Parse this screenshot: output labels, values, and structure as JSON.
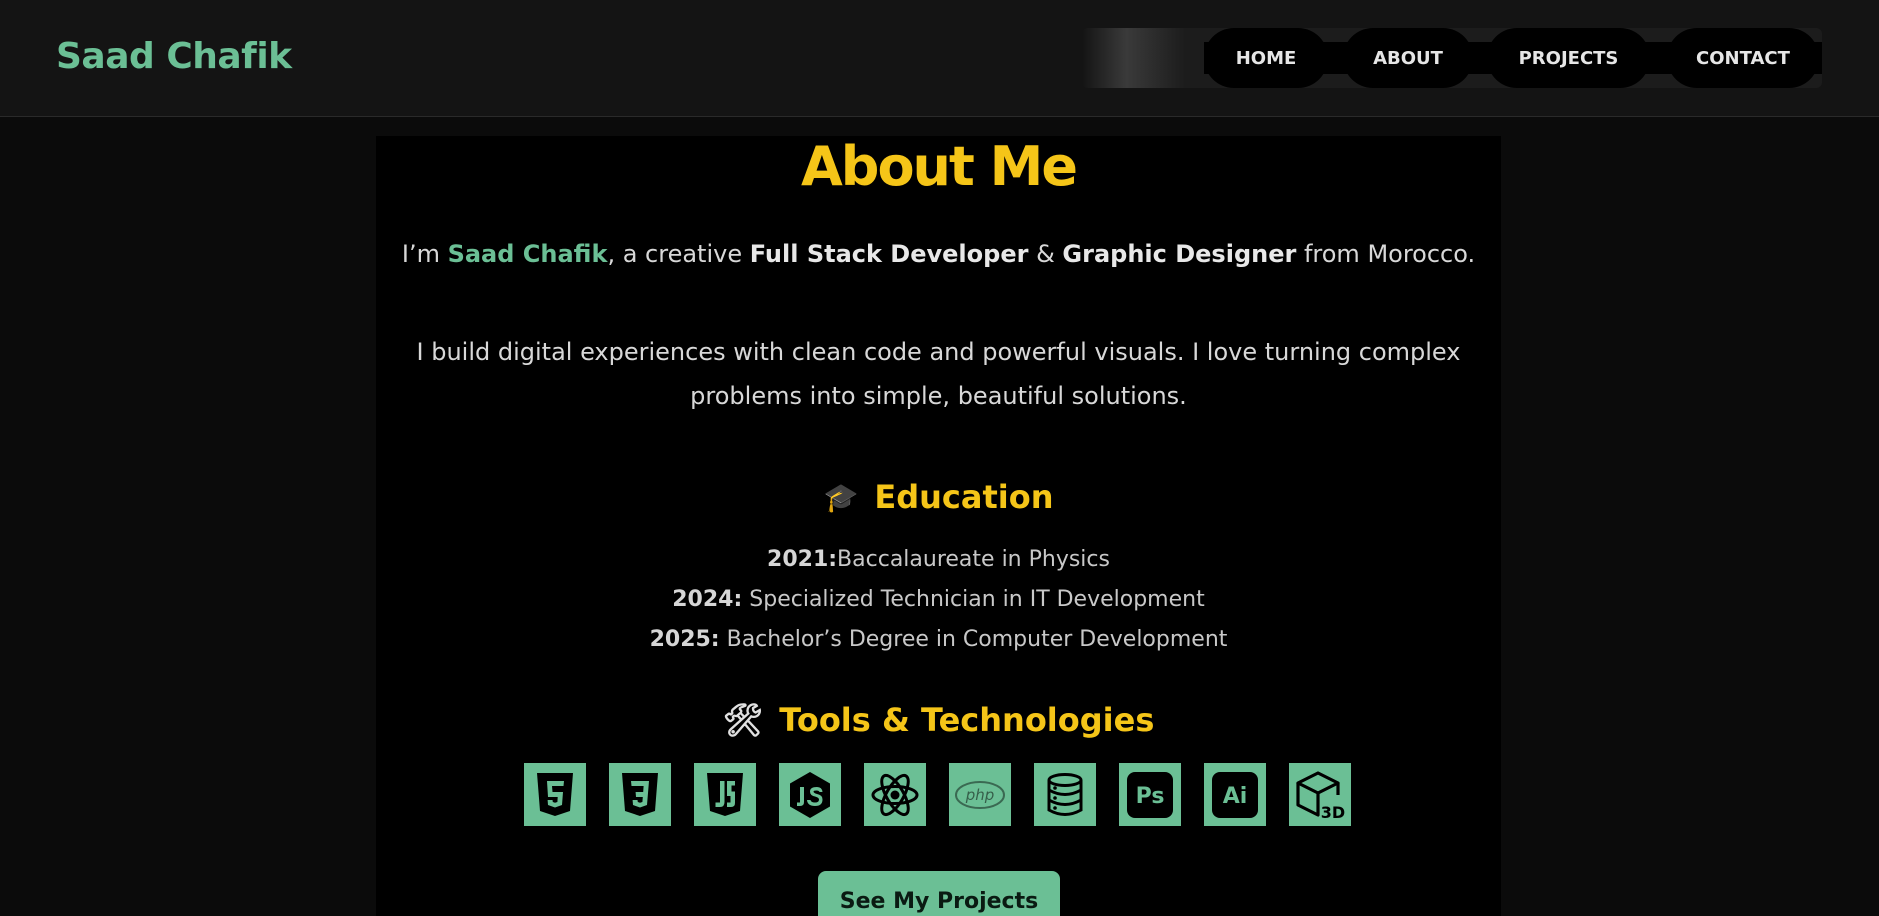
{
  "header": {
    "logo": "Saad Chafik",
    "nav": [
      {
        "label": "HOME"
      },
      {
        "label": "ABOUT"
      },
      {
        "label": "PROJECTS"
      },
      {
        "label": "CONTACT"
      }
    ]
  },
  "about": {
    "title": "About Me",
    "intro": {
      "prefix": "I’m ",
      "name": "Saad Chafik",
      "mid1": ", a creative ",
      "role1": "Full Stack Developer",
      "amp": " & ",
      "role2": "Graphic Designer",
      "suffix": " from Morocco."
    },
    "paragraph": {
      "line1": "I build digital experiences with clean code and powerful visuals. I love turning complex",
      "line2": "problems into simple, beautiful solutions."
    }
  },
  "education": {
    "icon": "graduation-cap-icon",
    "emoji": "🎓",
    "title": "Education",
    "items": [
      {
        "year": "2021:",
        "text": "Baccalaureate in Physics"
      },
      {
        "year": "2024:",
        "text": " Specialized Technician in IT Development"
      },
      {
        "year": "2025:",
        "text": " Bachelor’s Degree in Computer Development"
      }
    ]
  },
  "tools": {
    "icon": "tools-icon",
    "emoji": "🛠",
    "title": "Tools & Technologies",
    "items": [
      {
        "name": "html5-icon"
      },
      {
        "name": "css3-icon"
      },
      {
        "name": "javascript-icon"
      },
      {
        "name": "nodejs-icon"
      },
      {
        "name": "react-icon"
      },
      {
        "name": "php-icon",
        "text": "php"
      },
      {
        "name": "database-icon"
      },
      {
        "name": "photoshop-icon",
        "text": "Ps"
      },
      {
        "name": "illustrator-icon",
        "text": "Ai"
      },
      {
        "name": "3d-icon",
        "text": "3D"
      }
    ]
  },
  "cta": {
    "label": "See My Projects"
  },
  "colors": {
    "accent_green": "#6bbf95",
    "accent_yellow": "#f5c518",
    "background": "#0b0b0b"
  }
}
